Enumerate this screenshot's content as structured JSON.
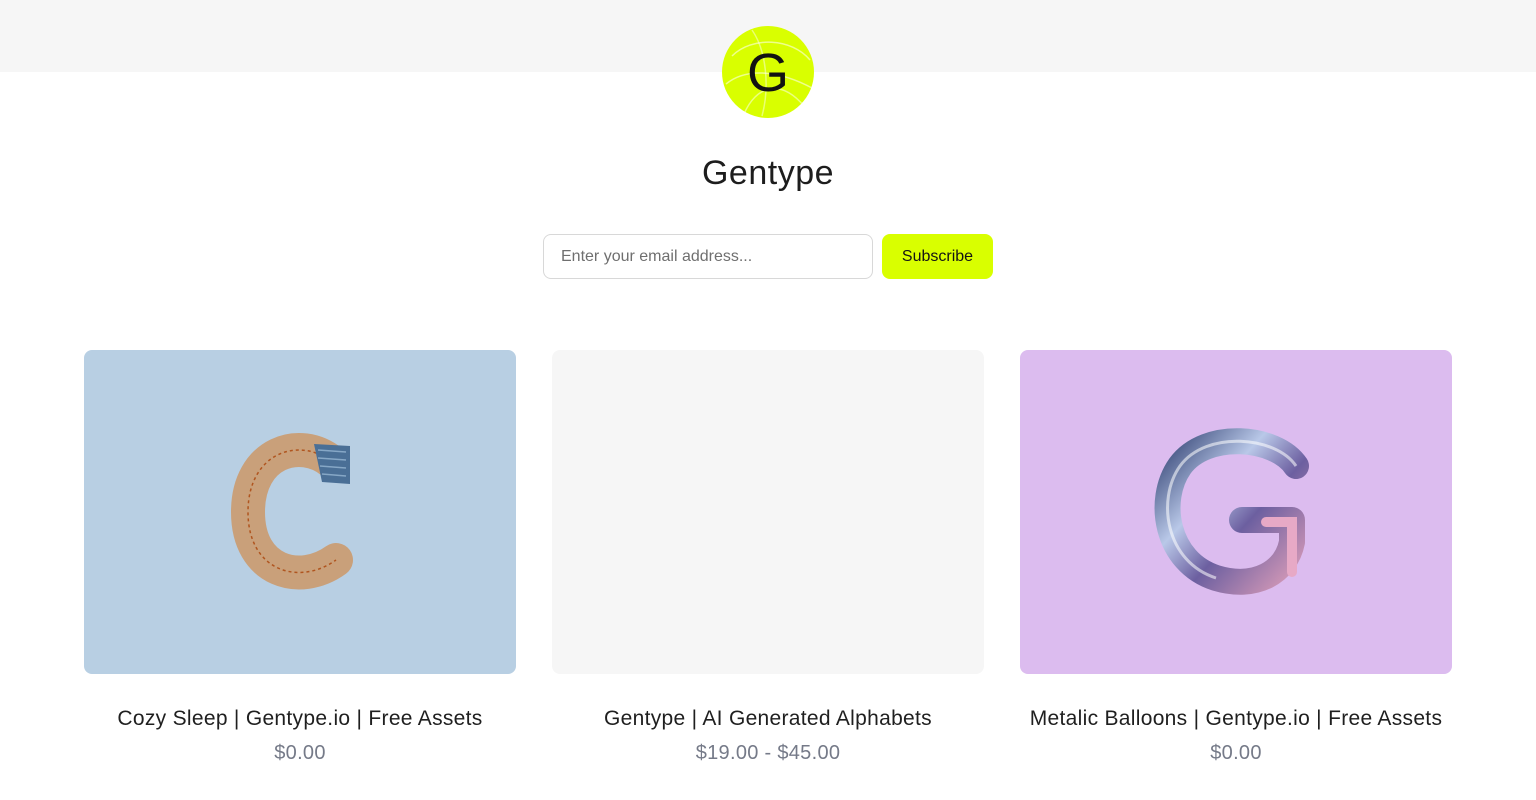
{
  "store": {
    "logo_letter": "G",
    "title": "Gentype"
  },
  "subscribe": {
    "email_placeholder": "Enter your email address...",
    "button_label": "Subscribe"
  },
  "products": [
    {
      "title": "Cozy Sleep | Gentype.io | Free Assets",
      "price": "$0.00",
      "image_bg": "#b8cfe3",
      "image_icon": "plush-letter-c-icon"
    },
    {
      "title": "Gentype | AI Generated Alphabets",
      "price": "$19.00 - $45.00",
      "image_bg": "#f6f6f6",
      "image_icon": ""
    },
    {
      "title": "Metalic Balloons | Gentype.io | Free Assets",
      "price": "$0.00",
      "image_bg": "#dcbcef",
      "image_icon": "balloon-letter-g-icon"
    }
  ],
  "colors": {
    "accent": "#d9ff00",
    "price_text": "#757a88",
    "header_band": "#f6f6f6"
  }
}
